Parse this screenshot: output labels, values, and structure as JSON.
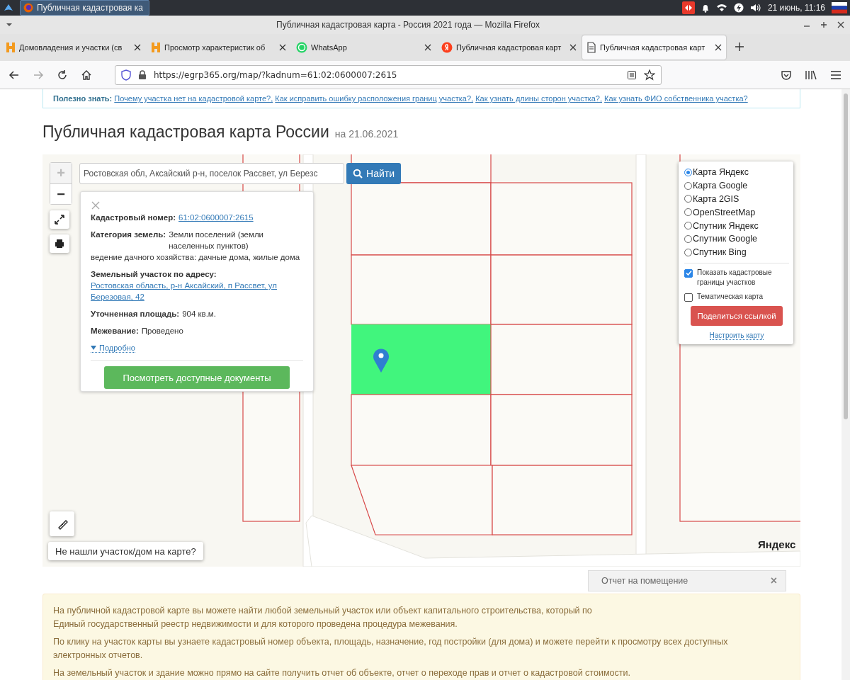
{
  "taskbar": {
    "task": {
      "label": "Публичная кадастровая ка",
      "selected": true
    },
    "clock": "21 июнь, 11:16"
  },
  "window": {
    "title": "Публичная кадастровая карта - Россия 2021 года — Mozilla Firefox"
  },
  "tabs": [
    {
      "label": "Домовладения и участки (св",
      "kind": "h",
      "selected": false
    },
    {
      "label": "Просмотр характеристик об",
      "kind": "h",
      "selected": false
    },
    {
      "label": "WhatsApp",
      "kind": "whatsapp",
      "selected": false
    },
    {
      "label": "Публичная кадастровая карт",
      "kind": "yandex",
      "selected": false
    },
    {
      "label": "Публичная кадастровая карт",
      "kind": "page",
      "selected": true
    }
  ],
  "address_bar": {
    "url": "https://egrp365.org/map/?kadnum=61:02:0600007:2615"
  },
  "useful": {
    "label": "Полезно знать:",
    "links": [
      "Почему участка нет на кадастровой карте?,",
      "Как исправить ошибку расположения границ участка?,",
      "Как узнать длины сторон участка?,",
      "Как узнать ФИО собственника участка?"
    ]
  },
  "heading": {
    "title": "Публичная кадастровая карта России",
    "date": "на 21.06.2021"
  },
  "map": {
    "search": {
      "value": "Ростовская обл, Аксайский р-н, поселок Рассвет, ул Березс"
    },
    "search_button": "Найти",
    "zoom": [
      {
        "label": "+",
        "disabled": true
      },
      {
        "label": "−",
        "disabled": false
      }
    ],
    "info": {
      "fields": [
        {
          "kind": "link",
          "label": "Кадастровый номер:",
          "value": "61:02:0600007:2615"
        },
        {
          "kind": "text",
          "label": "Категория земель:",
          "value": "Земли поселений (земли населенных пунктов)"
        },
        {
          "kind": "note",
          "value": "ведение дачного хозяйства: дачные дома, жилые дома"
        },
        {
          "kind": "link",
          "label": "Земельный участок по адресу:",
          "value": "Ростовская область, р-н Аксайский, п Рассвет, ул Березовая, 42"
        },
        {
          "kind": "text",
          "label": "Уточненная площадь:",
          "value": "904 кв.м."
        },
        {
          "kind": "text",
          "label": "Межевание:",
          "value": "Проведено"
        }
      ],
      "more": "Подробно",
      "documents_button": "Посмотреть доступные документы"
    },
    "layers": [
      {
        "label": "Карта Яндекс",
        "selected": true
      },
      {
        "label": "Карта Google",
        "selected": false
      },
      {
        "label": "Карта 2GIS",
        "selected": false
      },
      {
        "label": "OpenStreetMap",
        "selected": false
      },
      {
        "label": "Спутник Яндекс",
        "selected": false
      },
      {
        "label": "Спутник Google",
        "selected": false
      },
      {
        "label": "Спутник Bing",
        "selected": false
      }
    ],
    "options": [
      {
        "label": "Показать кадастровые границы участков",
        "checked": true
      },
      {
        "label": "Тематическая карта",
        "checked": false
      }
    ],
    "share_button": "Поделиться ссылкой",
    "configure_link": "Настроить карту",
    "not_found_button": "Не нашли участок/дом на карте?",
    "logo": "Яндекс"
  },
  "notice": {
    "paragraphs": [
      {
        "lines": [
          "На публичной кадастровой карте вы можете найти любой земельный участок или объект капитального строительства, который по",
          "Единый государственный реестр недвижимости и для которого проведена процедура межевания."
        ]
      },
      {
        "lines": [
          "По клику на участок карты вы узнаете кадастровый номер объекта, площадь, назначение, год постройки (для дома) и можете перейти к просмотру всех доступных",
          "электронных отчетов."
        ]
      },
      {
        "lines": [
          "На земельный участок и здание можно прямо на сайте получить отчет об объекте, отчет о переходе прав и отчет о кадастровой стоимости."
        ]
      }
    ]
  },
  "popup": {
    "label": "Отчет на помещение",
    "close": "×"
  }
}
